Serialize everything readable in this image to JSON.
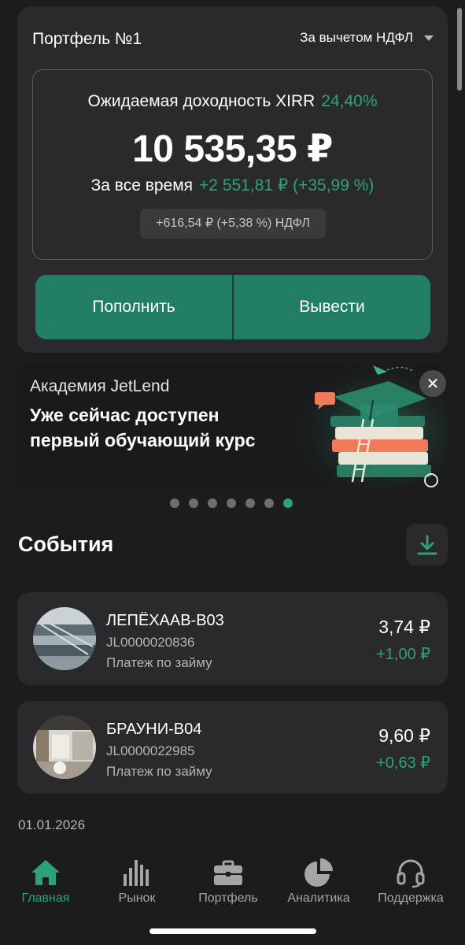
{
  "portfolio": {
    "title": "Портфель №1",
    "tax_mode": "За вычетом НДФЛ",
    "xirr_label": "Ожидаемая доходность XIRR",
    "xirr_value": "24,40%",
    "balance": "10 535,35 ₽",
    "alltime_label": "За все время",
    "alltime_value": "+2 551,81 ₽ (+35,99 %)",
    "ndfl_note": "+616,54 ₽ (+5,38 %) НДФЛ",
    "deposit_label": "Пополнить",
    "withdraw_label": "Вывести"
  },
  "banner": {
    "kicker": "Академия JetLend",
    "title_line1": "Уже сейчас доступен",
    "title_line2": "первый обучающий курс",
    "close_icon": "close-icon",
    "slides_total": 7,
    "active_slide": 7
  },
  "events": {
    "title": "События",
    "download_icon": "download-icon",
    "items": [
      {
        "name": "ЛЕПЁХААВ-В03",
        "id": "JL0000020836",
        "kind": "Платеж по займу",
        "amount": "3,74 ₽",
        "delta": "+1,00 ₽"
      },
      {
        "name": "БРАУНИ-В04",
        "id": "JL0000022985",
        "kind": "Платеж по займу",
        "amount": "9,60 ₽",
        "delta": "+0,63 ₽"
      }
    ],
    "next_date": "01.01.2026"
  },
  "nav": {
    "items": [
      {
        "label": "Главная",
        "icon": "home-icon",
        "active": true
      },
      {
        "label": "Рынок",
        "icon": "bar-chart-icon",
        "active": false
      },
      {
        "label": "Портфель",
        "icon": "briefcase-icon",
        "active": false
      },
      {
        "label": "Аналитика",
        "icon": "pie-chart-icon",
        "active": false
      },
      {
        "label": "Поддержка",
        "icon": "headset-icon",
        "active": false
      }
    ]
  },
  "colors": {
    "accent": "#2fa07e",
    "button": "#217e65",
    "background": "#1c1c1e",
    "card": "#2a2a2c"
  }
}
